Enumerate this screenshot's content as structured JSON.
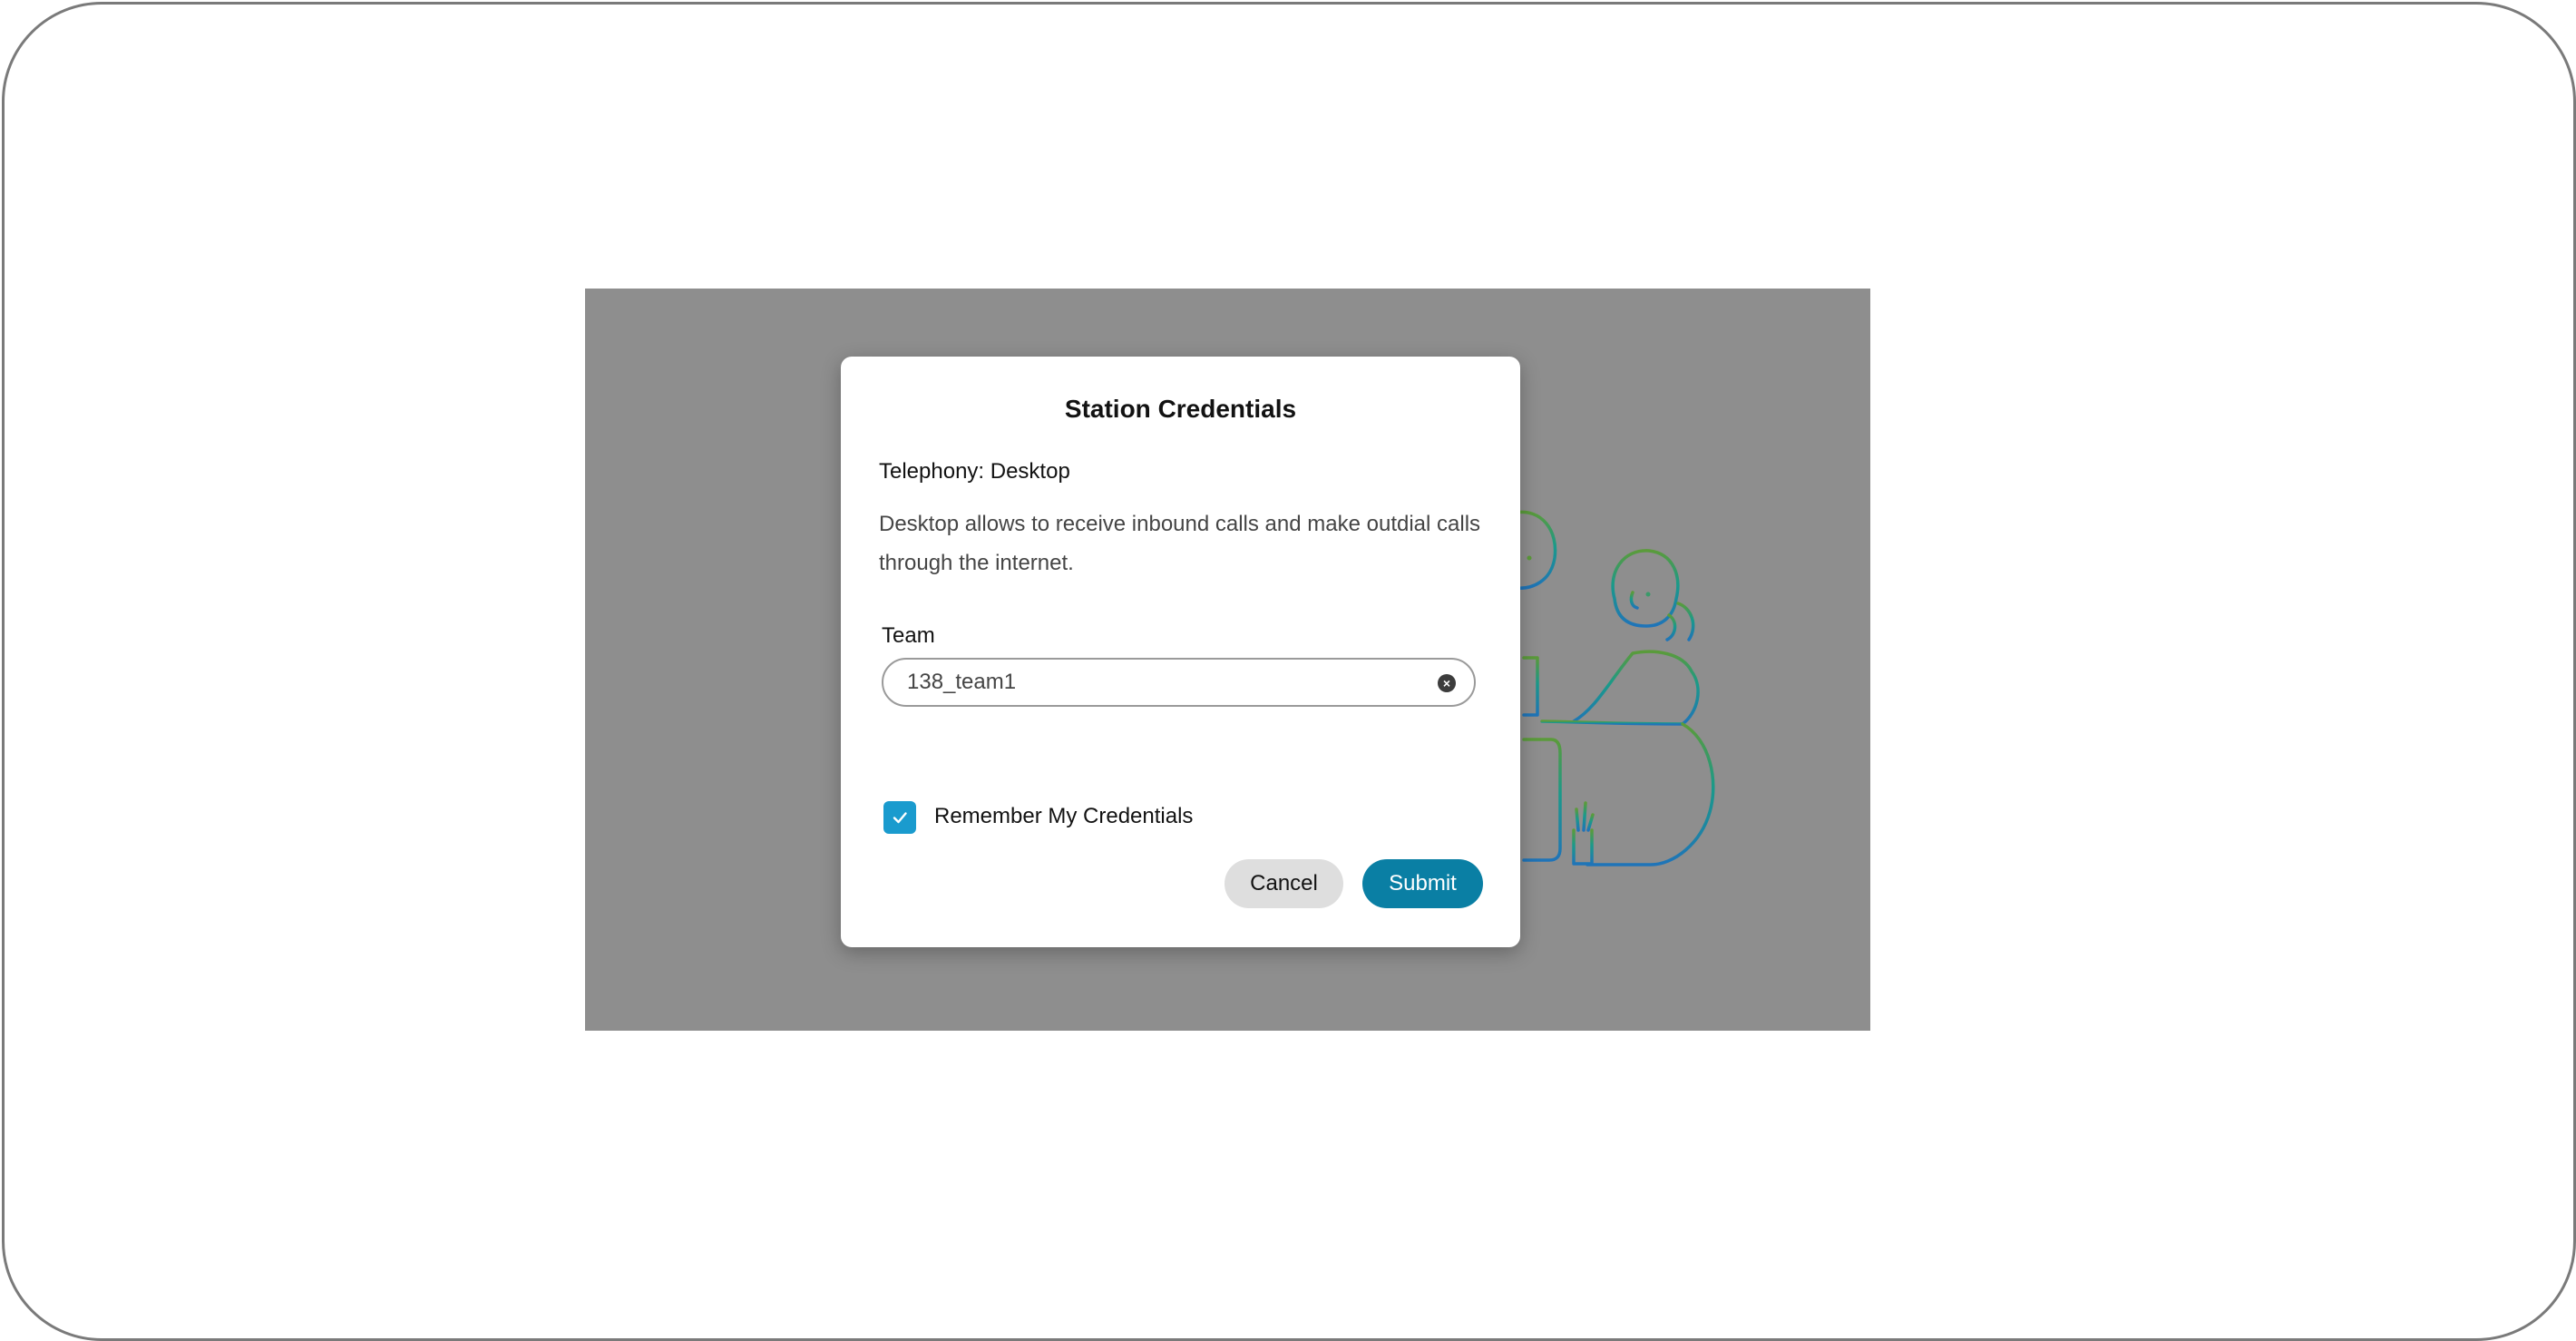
{
  "dialog": {
    "title": "Station Credentials",
    "telephony_label": "Telephony: Desktop",
    "description": "Desktop allows to receive inbound calls and make outdial calls through the internet.",
    "team_label": "Team",
    "team_value": "138_team1",
    "remember_label": "Remember My Credentials",
    "remember_checked": true,
    "cancel_label": "Cancel",
    "submit_label": "Submit"
  },
  "colors": {
    "overlay": "#8e8e8e",
    "accent": "#0a7fa4",
    "checkbox": "#1a9bce",
    "illustration_green": "#5b9b3a",
    "illustration_teal": "#1a8fa0",
    "illustration_blue": "#1f74b8"
  },
  "icons": {
    "clear": "clear-circle-icon",
    "checkbox": "checkmark-icon",
    "illustration": "agents-illustration"
  }
}
